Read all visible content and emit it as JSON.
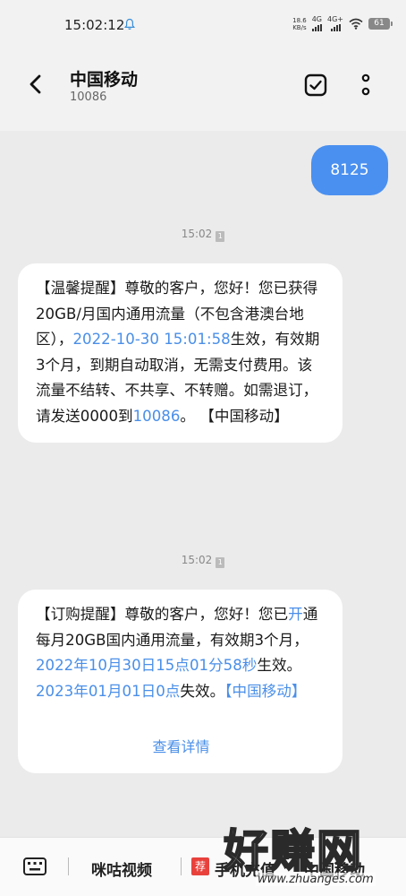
{
  "status_bar": {
    "time": "15:02:12",
    "net_speed": "18.6",
    "net_speed_unit": "KB/s",
    "sim1_type": "4G",
    "sim2_type": "4G+",
    "battery": "61"
  },
  "header": {
    "title": "中国移动",
    "number": "10086"
  },
  "messages": [
    {
      "direction": "sent",
      "text": "8125"
    },
    {
      "type": "timestamp",
      "time": "15:02"
    },
    {
      "direction": "received",
      "segments": [
        "【温馨提醒】尊敬的客户，您好！您已获得20GB/月国内通用流量（不包含港澳台地区），",
        "2022-10-30 15:01:58",
        "生效，有效期3个月，到期自动取消，无需支付费用。该流量不结转、不共享、不转赠。如需退订，请发送0000到",
        "10086",
        "。",
        "【中国移动】"
      ]
    },
    {
      "type": "timestamp",
      "time": "15:02"
    },
    {
      "direction": "received",
      "segments": [
        "【订购提醒】尊敬的客户，您好！您已",
        "开",
        "通每月20GB国内通用流量，有效期3个月，",
        "2022年10月30日15点01分58秒",
        "生效。",
        "2023年01月01日0点",
        "失效。",
        "【中国移动】"
      ],
      "action": "查看详情"
    }
  ],
  "bottom_menu": {
    "item1": "咪咕视频",
    "badge": "荐",
    "item2": "手机充值",
    "item3": "中国移动"
  },
  "watermark": {
    "text": "好赚网",
    "url": "www.zhuanges.com"
  },
  "sim_label": "1",
  "colors": {
    "accent": "#4a8fe8",
    "sent_bubble": "#4a90f0",
    "badge": "#e8413c"
  }
}
